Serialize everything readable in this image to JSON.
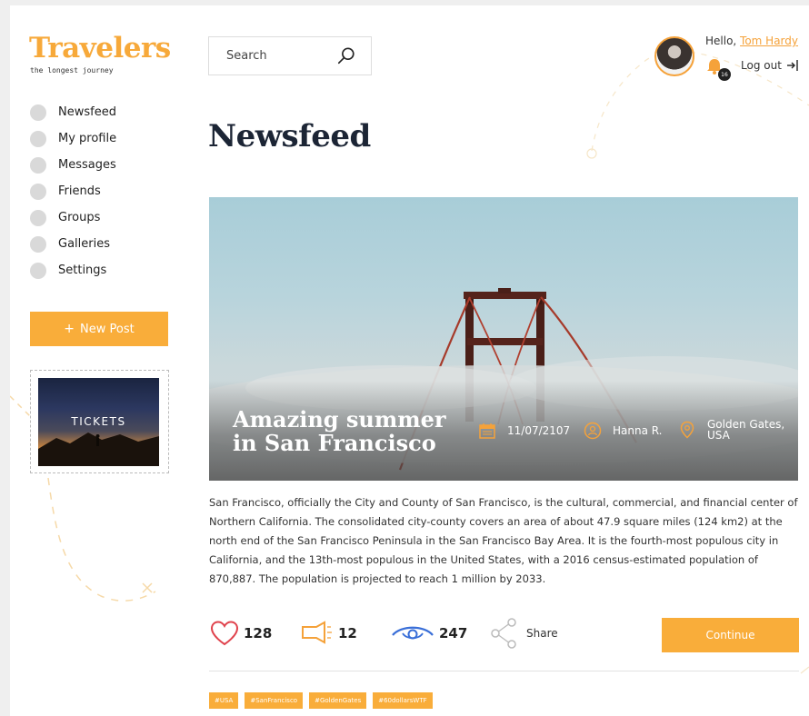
{
  "logo": {
    "title": "Travelers",
    "subtitle": "the longest journey"
  },
  "nav": [
    {
      "label": "Newsfeed"
    },
    {
      "label": "My profile"
    },
    {
      "label": "Messages"
    },
    {
      "label": "Friends"
    },
    {
      "label": "Groups"
    },
    {
      "label": "Galleries"
    },
    {
      "label": "Settings"
    }
  ],
  "new_post": {
    "icon": "+",
    "label": "New Post"
  },
  "ticket": {
    "label": "TICKETS"
  },
  "search": {
    "placeholder": "Search",
    "value": ""
  },
  "user": {
    "greeting": "Hello, ",
    "name": "Tom Hardy",
    "notifications": "16",
    "logout": "Log out"
  },
  "page_title": "Newsfeed",
  "post": {
    "title": "Amazing summer in San Francisco",
    "date": "11/07/2107",
    "author": "Hanna R.",
    "location": "Golden Gates, USA",
    "body": "San Francisco, officially the City and County of San Francisco, is the cultural, commercial, and financial center of Northern California. The consolidated city-county covers an area of about 47.9 square miles (124 km2) at the north end of the San Francisco Peninsula in the San Francisco Bay Area. It is the fourth-most populous city in California, and the 13th-most populous in the United States, with a 2016 census-estimated population of 870,887. The population is projected to reach 1 million by 2033.",
    "likes": "128",
    "shouts": "12",
    "views": "247",
    "share_label": "Share",
    "continue_label": "Continue",
    "tags": [
      "#USA",
      "#SanFrancisco",
      "#GoldenGates",
      "#60dollarsWTF"
    ]
  },
  "colors": {
    "accent": "#f9ad3a",
    "title": "#1c2535",
    "heart": "#e0434d",
    "eye": "#3a6fd8"
  }
}
